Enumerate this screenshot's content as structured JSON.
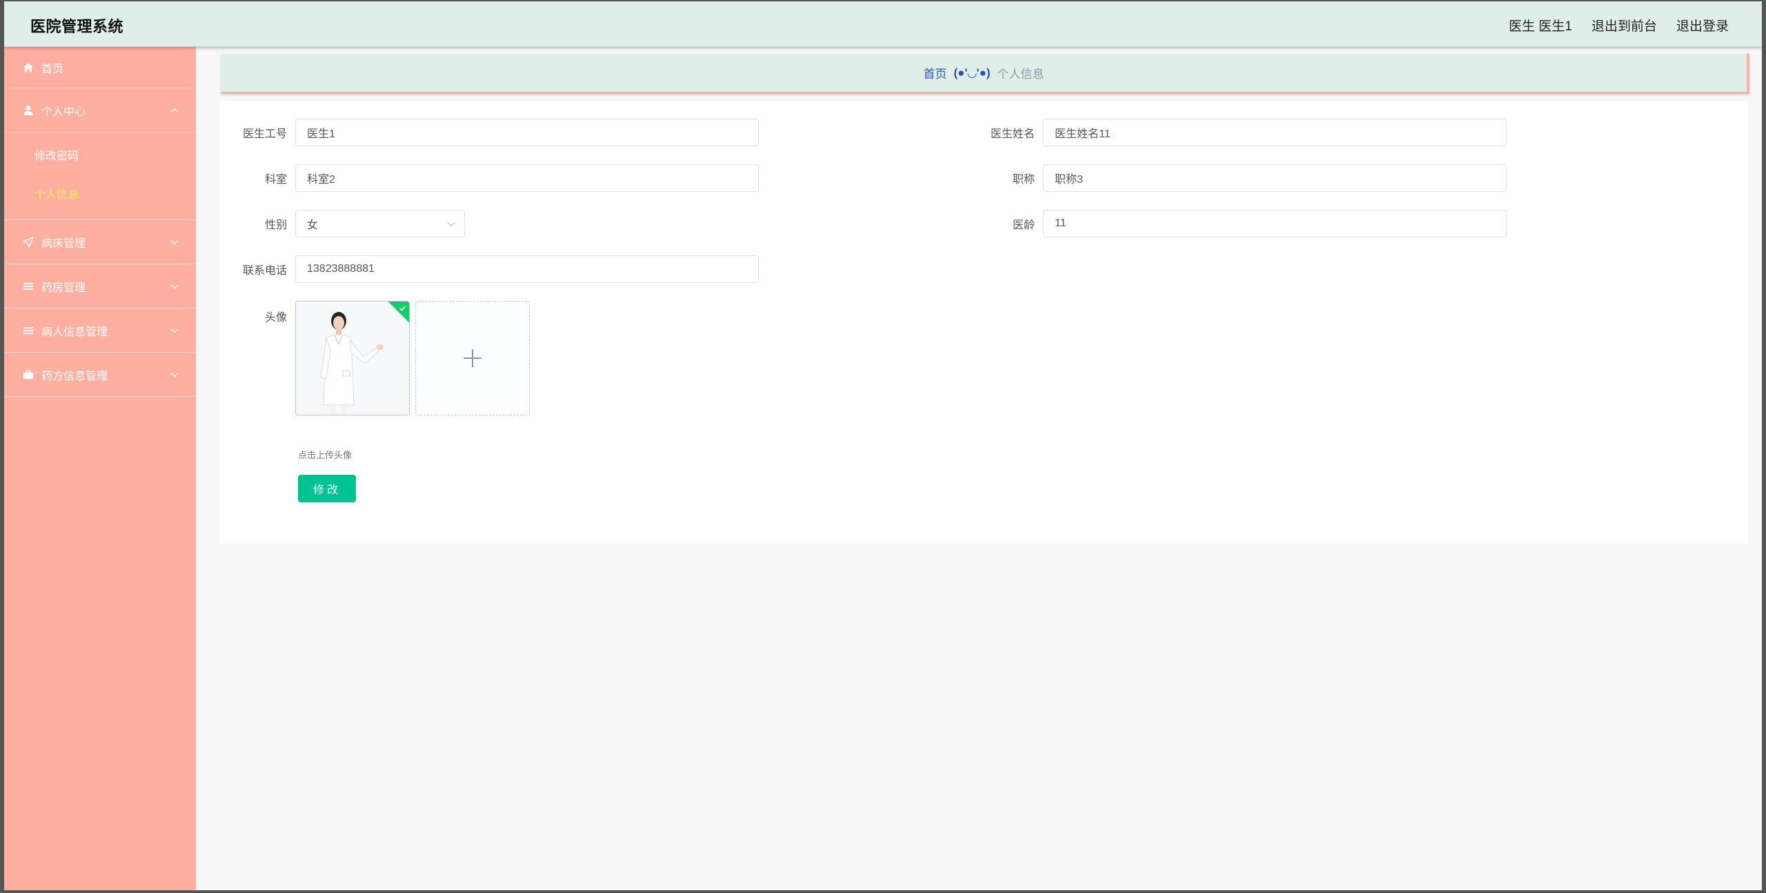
{
  "header": {
    "app_title": "医院管理系统",
    "user_label": "医生 医生1",
    "back_front": "退出到前台",
    "logout": "退出登录"
  },
  "sidebar": {
    "home": "首页",
    "personal_center": "个人中心",
    "change_password": "修改密码",
    "personal_info": "个人信息",
    "items": [
      {
        "label": "病床管理",
        "icon": "send-icon"
      },
      {
        "label": "药房管理",
        "icon": "list-icon"
      },
      {
        "label": "病人信息管理",
        "icon": "list-icon"
      },
      {
        "label": "药方信息管理",
        "icon": "briefcase-icon"
      }
    ]
  },
  "breadcrumb": {
    "home": "首页",
    "separator": "(●'◡'●)",
    "current": "个人信息"
  },
  "form": {
    "doctor_id_label": "医生工号",
    "doctor_id_value": "医生1",
    "doctor_name_label": "医生姓名",
    "doctor_name_value": "医生姓名11",
    "department_label": "科室",
    "department_value": "科室2",
    "title_label": "职称",
    "title_value": "职称3",
    "gender_label": "性别",
    "gender_value": "女",
    "seniority_label": "医龄",
    "seniority_value": "11",
    "phone_label": "联系电话",
    "phone_value": "13823888881",
    "avatar_label": "头像",
    "upload_tip": "点击上传头像",
    "save_button": "修改"
  },
  "colors": {
    "sidebar_bg": "#ffafa0",
    "header_bg": "#dfeee8",
    "active_submenu": "#fff34d",
    "primary_button": "#00c292",
    "success_badge": "#13ce66"
  }
}
